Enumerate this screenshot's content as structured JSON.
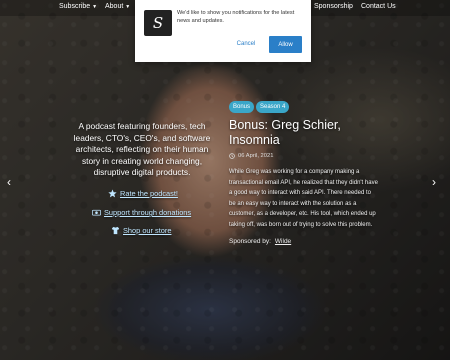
{
  "nav": {
    "items": [
      {
        "label": "Subscribe",
        "dropdown": true
      },
      {
        "label": "About",
        "dropdown": true
      },
      {
        "label": "Sponsorship",
        "dropdown": false
      },
      {
        "label": "Contact Us",
        "dropdown": false
      }
    ]
  },
  "notification": {
    "logo_letter": "S",
    "message": "We'd like to show you notifications for the latest news and updates.",
    "cancel_label": "Cancel",
    "allow_label": "Allow",
    "accent_color": "#2a7fc8"
  },
  "intro": {
    "text": "A podcast featuring founders, tech leaders, CTO's, CEO's, and software architects, reflecting on their human story in creating world changing, disruptive digital products.",
    "links": [
      {
        "label": "Rate the podcast!",
        "icon": "star-icon"
      },
      {
        "label": "Support through donations",
        "icon": "money-icon"
      },
      {
        "label": "Shop our store",
        "icon": "tshirt-icon"
      }
    ]
  },
  "episode": {
    "tags": [
      "Bonus",
      "Season 4"
    ],
    "title": "Bonus: Greg Schier, Insomnia",
    "date": "06 April, 2021",
    "body": "While Greg was working for a company making a transactional email API, he realized that they didn't have a good way to interact with said API. There needed to be an easy way to interact with the solution as a customer, as a developer, etc. His tool, which ended up taking off, was born out of trying to solve this problem.",
    "sponsor_label": "Sponsored by:",
    "sponsor_name": "Wilde"
  },
  "slider": {
    "prev_icon": "chevron-left-icon",
    "next_icon": "chevron-right-icon"
  }
}
